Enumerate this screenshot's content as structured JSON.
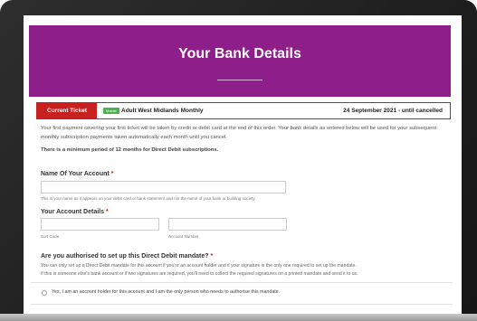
{
  "header": {
    "title": "Your Bank Details"
  },
  "ticket": {
    "tab_label": "Current Ticket",
    "badge": "Mobile",
    "name": "Adult West Midlands Monthly",
    "date_range": "24 September 2021 - until cancelled"
  },
  "intro": {
    "paragraph": "Your first payment covering your first ticket will be taken by credit or debit card at the end of this order. Your bank details as entered below will be used for your subsequent monthly subscription payments taken automatically each month until you cancel.",
    "minimum_period": "There is a minimum period of 12 months for Direct Debit subscriptions."
  },
  "account_name": {
    "label": "Name Of Your Account",
    "required_mark": "*",
    "value": "",
    "hint": "This is your name as it appears on your debit card or bank statement and not the name of your bank or building society."
  },
  "account_details": {
    "label": "Your Account Details",
    "required_mark": "*",
    "sort_code_value": "",
    "sort_code_hint": "Sort Code",
    "account_number_value": "",
    "account_number_hint": "Account Number"
  },
  "mandate": {
    "question": "Are you authorised to set up this Direct Debit mandate?",
    "required_mark": "*",
    "line1": "You can only set up a Direct Debit mandate for this account if you're an account holder and if your signature is the only one required to set up the mandate.",
    "line2": "If this is someone else's bank account or if two signatures are required, you'll need to collect the required signatures on a printed mandate and send it to us.",
    "option_yes": "Yes, I am an account holder for this account and I am the only person who needs to authorise this mandate."
  },
  "colors": {
    "header_bg": "#8e1e8a",
    "accent_red": "#c8201f",
    "badge_green": "#4caf50"
  }
}
